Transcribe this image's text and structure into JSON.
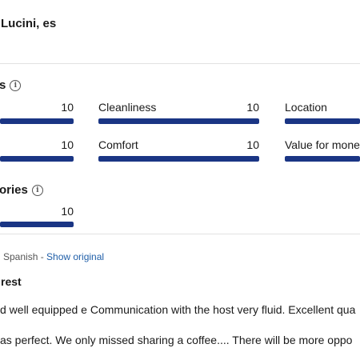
{
  "reviewer": {
    "name": "Lucini, es"
  },
  "ratings": {
    "title": "s",
    "items": [
      {
        "label": "",
        "score": "10",
        "fraction": 1.0
      },
      {
        "label": "Cleanliness",
        "score": "10",
        "fraction": 1.0
      },
      {
        "label": "Location",
        "score": "",
        "fraction": 1.0
      },
      {
        "label": "",
        "score": "10",
        "fraction": 1.0
      },
      {
        "label": "Comfort",
        "score": "10",
        "fraction": 1.0
      },
      {
        "label": "Value for mone",
        "score": "",
        "fraction": 1.0
      }
    ]
  },
  "categories": {
    "title": "ories",
    "items": [
      {
        "label": "",
        "score": "10",
        "fraction": 1.0
      }
    ]
  },
  "translation": {
    "prefix": "Spanish - ",
    "link": "Show original"
  },
  "review": {
    "title": "rest",
    "lines": [
      "d well equipped e Communication with the host very fluid. Excellent qua",
      "as perfect. We only missed sharing a coffee.... There will be more oppo"
    ]
  },
  "colors": {
    "bar_fill": "#1a3584",
    "bar_track": "#d8dbe6",
    "link": "#1f5ea8"
  }
}
